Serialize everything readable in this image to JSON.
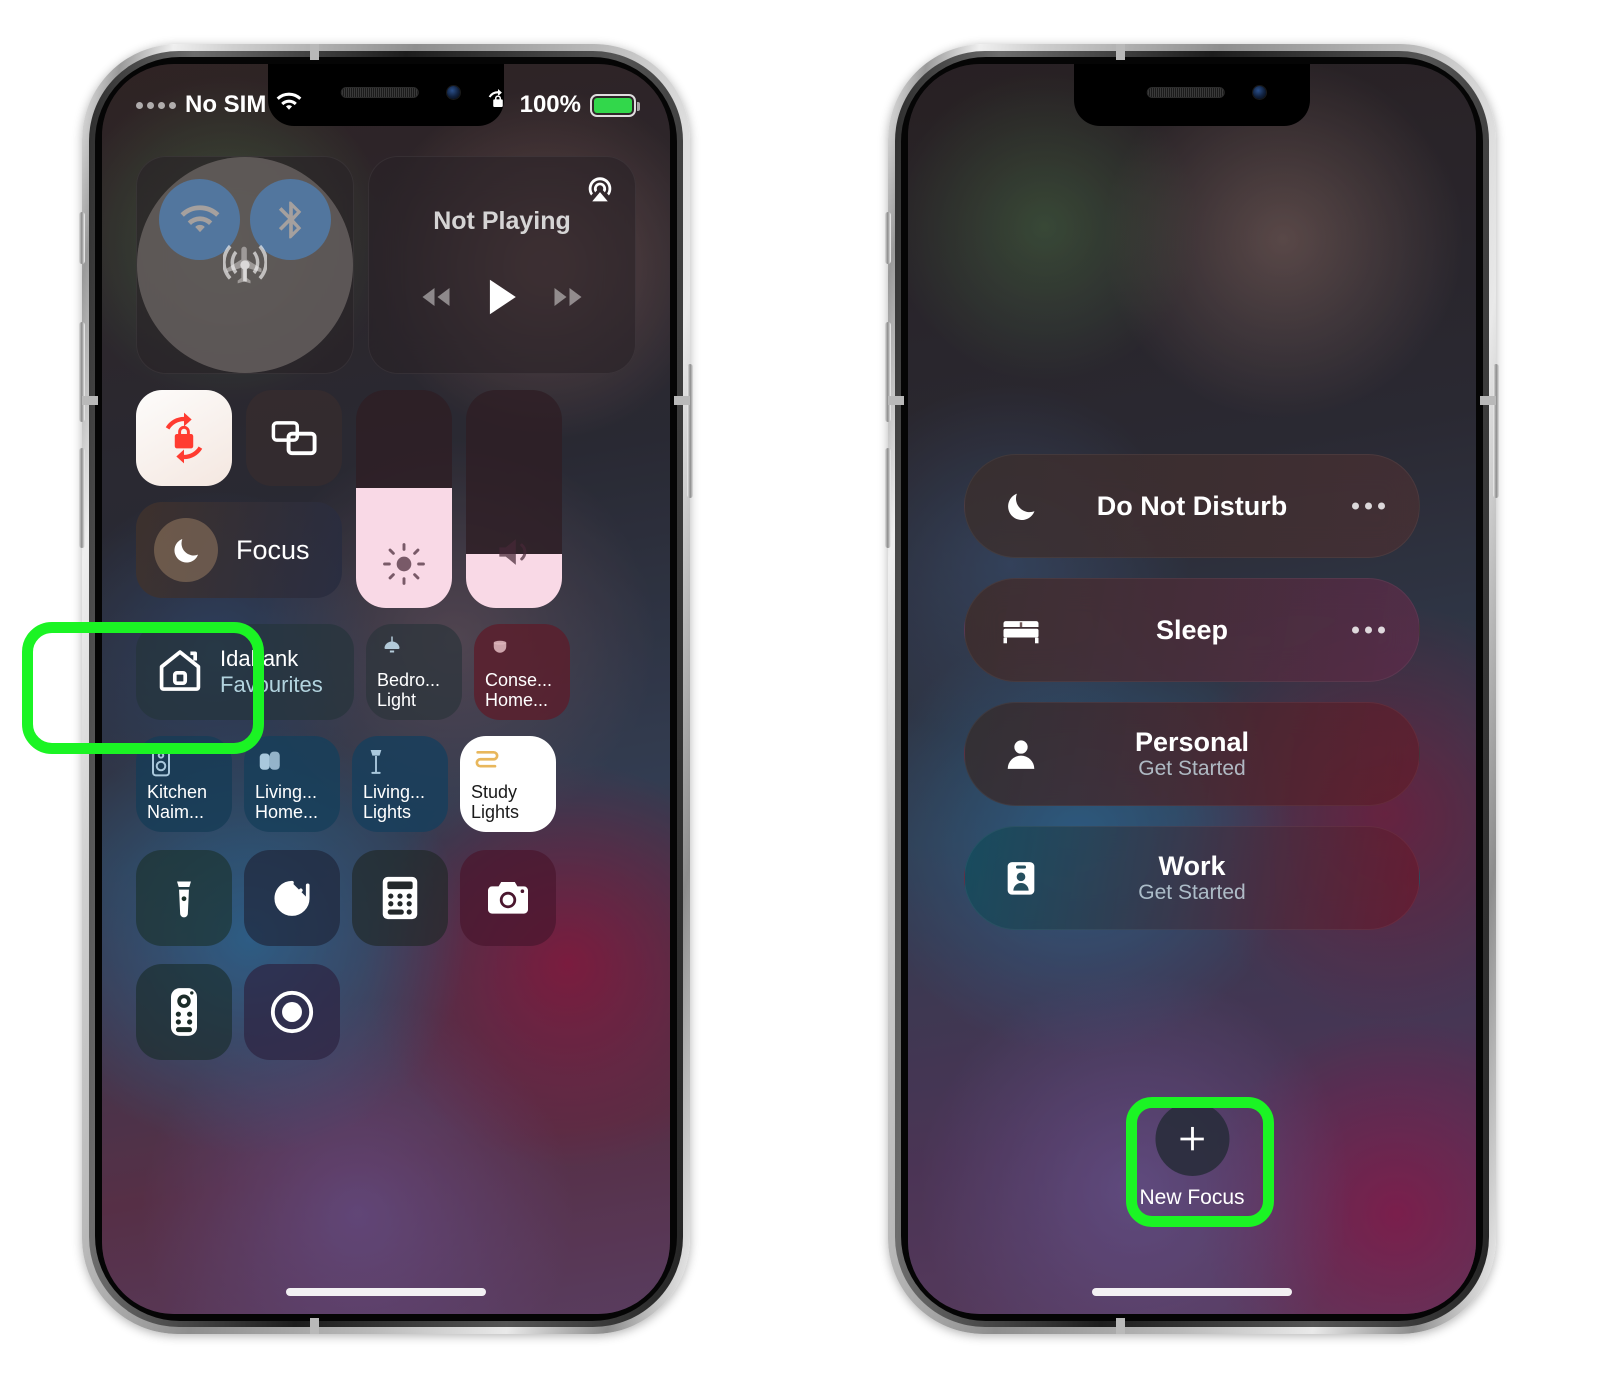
{
  "background_color": "#ffffff",
  "highlight_color": "#1bf424",
  "phones": {
    "left": {
      "name": "control-center-screen",
      "status_bar": {
        "carrier": "No SIM",
        "wifi_icon": "wifi-icon",
        "orientation_lock_icon": "rotation-lock-icon",
        "battery_percent": "100%",
        "battery_icon": "battery-charging-icon",
        "battery_color": "#32d74b"
      },
      "connectivity": {
        "airplane": {
          "label": "airplane-mode",
          "state": "off"
        },
        "cellular": {
          "label": "cellular-data",
          "state": "off"
        },
        "wifi": {
          "label": "wi-fi",
          "state": "on",
          "color": "#0a84ff"
        },
        "bluetooth": {
          "label": "bluetooth",
          "state": "on",
          "color": "#0a84ff"
        }
      },
      "media": {
        "title": "Not Playing",
        "airplay_icon": "airplay-audio-icon",
        "rewind_icon": "rewind-icon",
        "play_icon": "play-icon",
        "forward_icon": "fast-forward-icon"
      },
      "toggles": {
        "rotation_lock": {
          "name": "rotation-lock-tile",
          "state": "on"
        },
        "screen_mirroring": {
          "name": "screen-mirroring-tile",
          "state": "off"
        }
      },
      "focus_tile": {
        "label": "Focus",
        "icon": "moon-icon",
        "highlighted": true
      },
      "brightness_slider": {
        "name": "brightness-slider",
        "value": 55,
        "icon": "sun-icon"
      },
      "volume_slider": {
        "name": "volume-slider",
        "value": 25,
        "icon": "speaker-icon"
      },
      "home": {
        "main_tile": {
          "title": "Idabank",
          "subtitle": "Favourites",
          "icon": "house-icon"
        },
        "tiles": [
          {
            "line1": "Bedro...",
            "line2": "Light",
            "icon": "pendant-lamp-icon",
            "style": "dark"
          },
          {
            "line1": "Conse...",
            "line2": "Home...",
            "icon": "sensor-icon",
            "style": "dark"
          },
          {
            "line1": "Kitchen",
            "line2": "Naim...",
            "icon": "speaker-box-icon",
            "style": "dark"
          },
          {
            "line1": "Living...",
            "line2": "Home...",
            "icon": "speakers-icon",
            "style": "dark"
          },
          {
            "line1": "Living...",
            "line2": "Lights",
            "icon": "floor-lamp-icon",
            "style": "dark"
          },
          {
            "line1": "Study",
            "line2": "Lights",
            "icon": "lightstrip-icon",
            "style": "white"
          }
        ]
      },
      "utilities": [
        {
          "name": "flashlight-button",
          "icon": "flashlight-icon"
        },
        {
          "name": "timer-button",
          "icon": "timer-icon"
        },
        {
          "name": "calculator-button",
          "icon": "calculator-icon"
        },
        {
          "name": "camera-button",
          "icon": "camera-icon"
        },
        {
          "name": "apple-tv-remote-button",
          "icon": "remote-icon"
        },
        {
          "name": "screen-record-button",
          "icon": "record-icon"
        }
      ]
    },
    "right": {
      "name": "focus-menu-screen",
      "items": [
        {
          "title": "Do Not Disturb",
          "subtitle": "",
          "icon": "moon-icon",
          "has_more": true
        },
        {
          "title": "Sleep",
          "subtitle": "",
          "icon": "bed-icon",
          "has_more": true
        },
        {
          "title": "Personal",
          "subtitle": "Get Started",
          "icon": "person-icon",
          "has_more": false
        },
        {
          "title": "Work",
          "subtitle": "Get Started",
          "icon": "id-badge-icon",
          "has_more": false
        }
      ],
      "new_focus": {
        "label": "New Focus",
        "icon": "plus-icon",
        "highlighted": true
      }
    }
  }
}
